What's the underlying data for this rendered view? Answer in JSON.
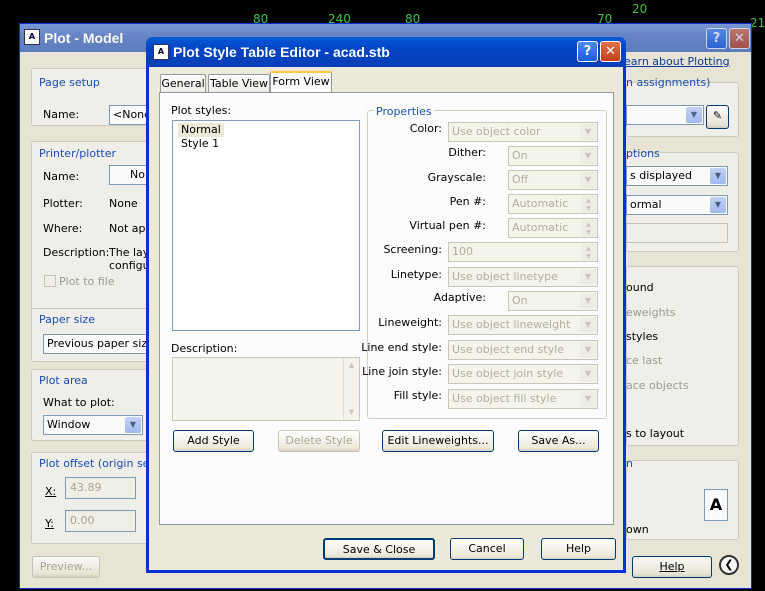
{
  "background": {
    "numbers": [
      "80",
      "240",
      "80",
      "70",
      "20",
      "21"
    ]
  },
  "plot_model": {
    "title": "Plot - Model",
    "page_setup": {
      "label": "Page setup",
      "name_label": "Name:",
      "name_value": "<None"
    },
    "printer": {
      "label": "Printer/plotter",
      "name_label": "Name:",
      "name_value": "No",
      "plotter_label": "Plotter:",
      "plotter_value": "None",
      "where_label": "Where:",
      "where_value": "Not app",
      "desc_label": "Description:",
      "desc_value1": "The lay",
      "desc_value2": "configu",
      "plot_to_file": "Plot to file"
    },
    "paper_size": {
      "label": "Paper size",
      "value": "Previous paper size ("
    },
    "plot_area": {
      "label": "Plot area",
      "what_label": "What to plot:",
      "what_value": "Window"
    },
    "plot_offset": {
      "label": "Plot offset (origin set t",
      "x_label": "X:",
      "x_value": "43.89",
      "y_label": "Y:",
      "y_value": "0.00"
    },
    "preview_label": "Preview...",
    "help_label": "Help",
    "learn_link": "earn about Plotting",
    "assignments": "n assignments)",
    "options_label": "ptions",
    "shaded_value": "s displayed",
    "quality_value": "ormal",
    "right_items": [
      "ound",
      "eweights",
      "styles",
      "ce last",
      "ace objects",
      "s to layout"
    ],
    "orient_label": "n",
    "orient_value": "own"
  },
  "dialog": {
    "title": "Plot Style Table Editor - acad.stb",
    "tabs": [
      "General",
      "Table View",
      "Form View"
    ],
    "plot_styles_label": "Plot styles:",
    "plot_styles": [
      "Normal",
      "Style 1"
    ],
    "description_label": "Description:",
    "properties_label": "Properties",
    "properties": [
      {
        "label": "Color:",
        "value": "Use object color"
      },
      {
        "label": "Dither:",
        "value": "On"
      },
      {
        "label": "Grayscale:",
        "value": "Off"
      },
      {
        "label": "Pen #:",
        "value": "Automatic"
      },
      {
        "label": "Virtual pen #:",
        "value": "Automatic"
      },
      {
        "label": "Screening:",
        "value": "100"
      },
      {
        "label": "Linetype:",
        "value": "Use object linetype"
      },
      {
        "label": "Adaptive:",
        "value": "On"
      },
      {
        "label": "Lineweight:",
        "value": "Use object lineweight"
      },
      {
        "label": "Line end style:",
        "value": "Use object end style"
      },
      {
        "label": "Line join style:",
        "value": "Use object join style"
      },
      {
        "label": "Fill style:",
        "value": "Use object fill style"
      }
    ],
    "add_style": "Add Style",
    "delete_style": "Delete Style",
    "edit_lineweights": "Edit Lineweights...",
    "save_as": "Save As...",
    "save_close": "Save & Close",
    "cancel": "Cancel",
    "help": "Help"
  }
}
